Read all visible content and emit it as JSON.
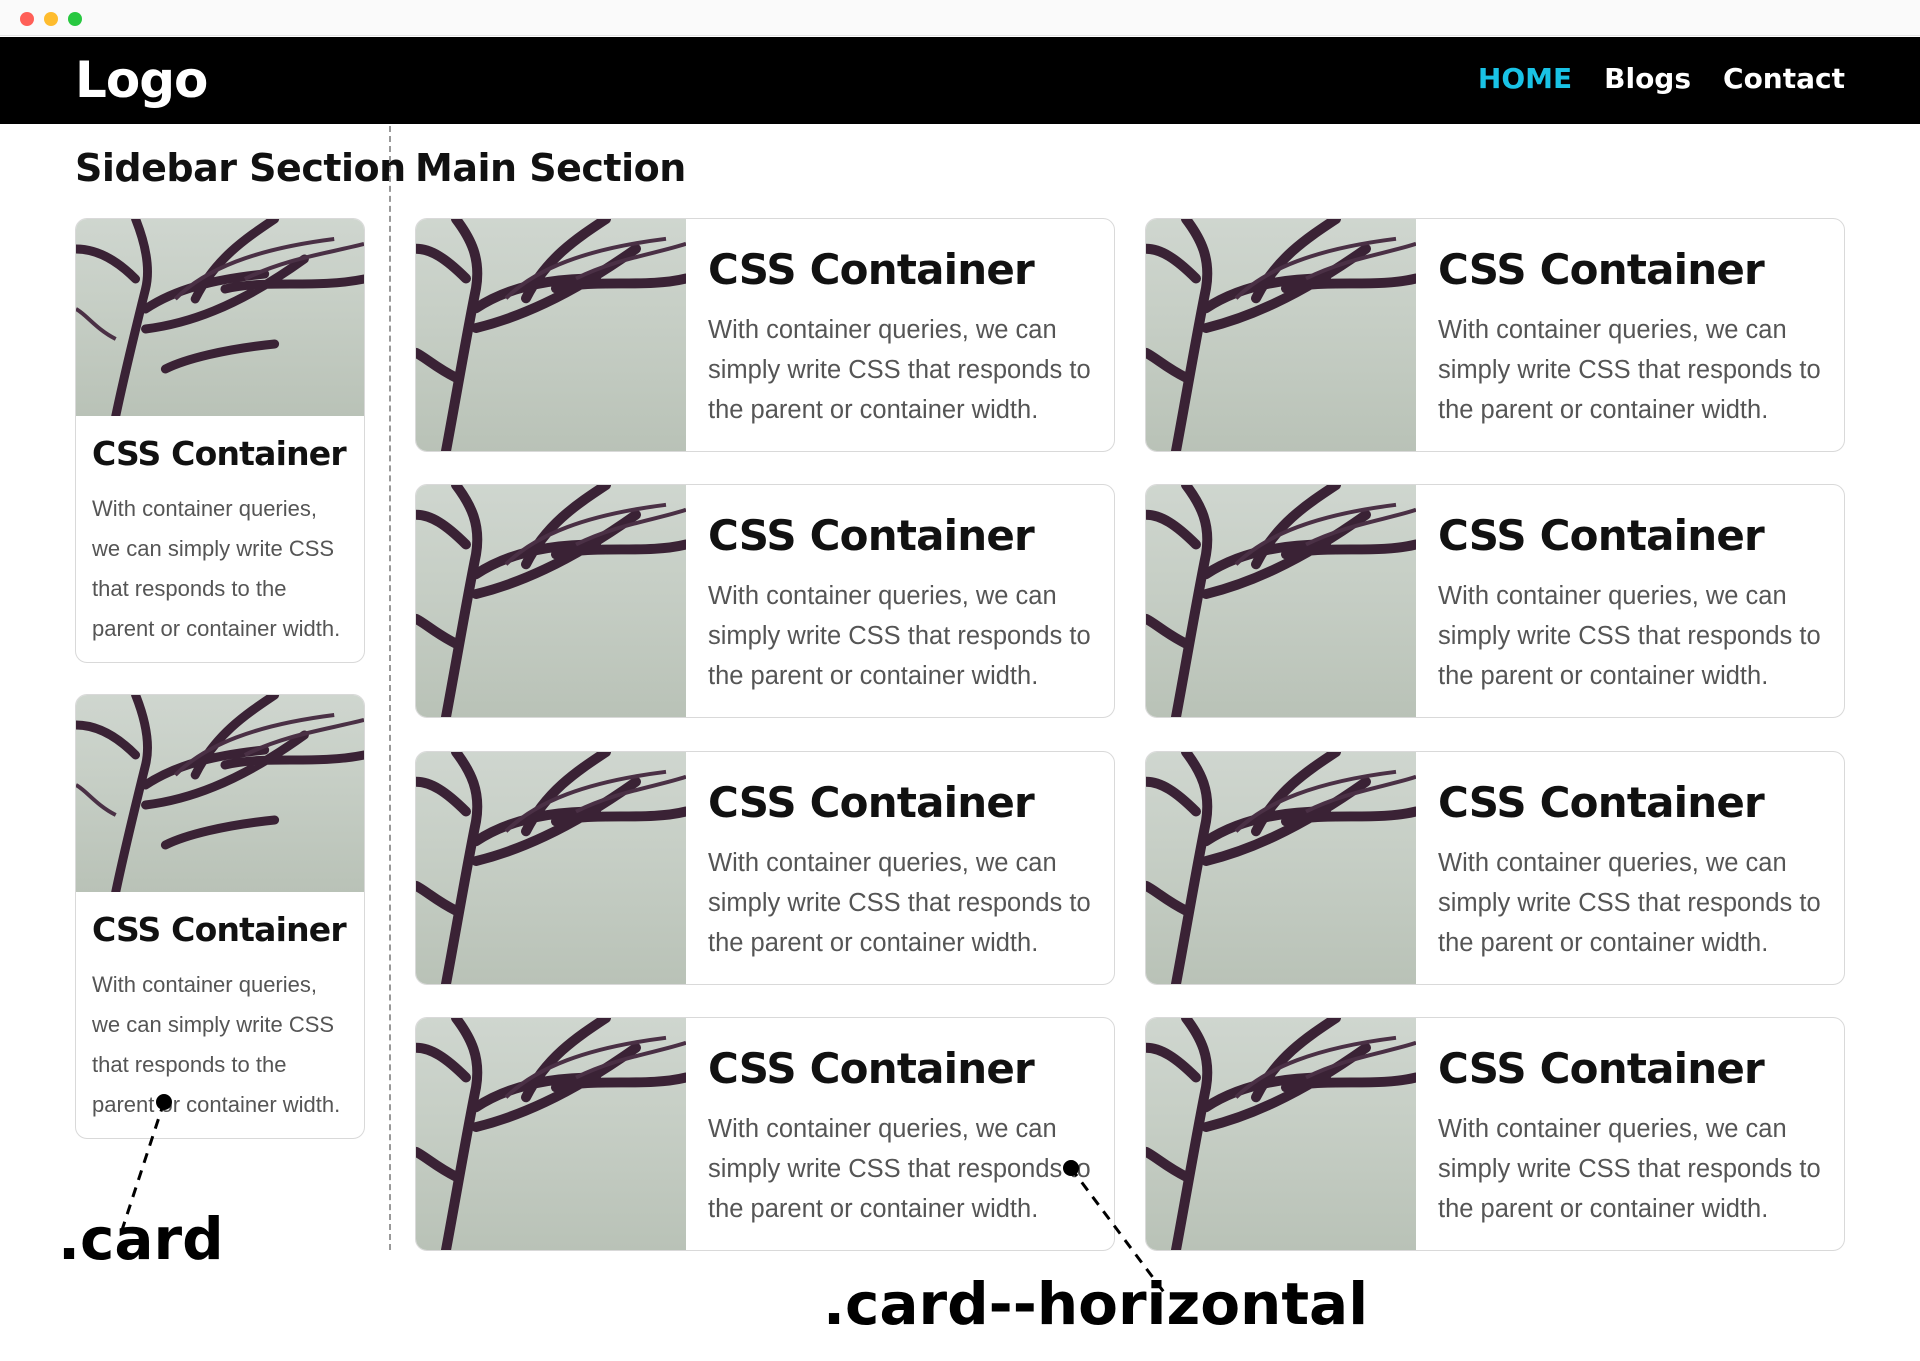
{
  "nav": {
    "logo": "Logo",
    "links": [
      "HOME",
      "Blogs",
      "Contact"
    ],
    "active_color": "#19c3e6"
  },
  "sidebar": {
    "title": "Sidebar Section",
    "cards": [
      {
        "title": "CSS Container",
        "text": "With container queries, we can simply write CSS that responds to the parent or container width."
      },
      {
        "title": "CSS Container",
        "text": "With container queries, we can simply write CSS that responds to the parent or container width."
      }
    ]
  },
  "main": {
    "title": "Main Section",
    "cards": [
      {
        "title": "CSS Container",
        "text": "With container queries, we can simply write CSS that responds to the parent or container width."
      },
      {
        "title": "CSS Container",
        "text": "With container queries, we can simply write CSS that responds to the parent or container width."
      },
      {
        "title": "CSS Container",
        "text": "With container queries, we can simply write CSS that responds to the parent or container width."
      },
      {
        "title": "CSS Container",
        "text": "With container queries, we can simply write CSS that responds to the parent or container width."
      },
      {
        "title": "CSS Container",
        "text": "With container queries, we can simply write CSS that responds to the parent or container width."
      },
      {
        "title": "CSS Container",
        "text": "With container queries, we can simply write CSS that responds to the parent or container width."
      },
      {
        "title": "CSS Container",
        "text": "With container queries, we can simply write CSS that responds to the parent or container width."
      },
      {
        "title": "CSS Container",
        "text": "With container queries, we can simply write CSS that responds to the parent or container width."
      }
    ]
  },
  "annotations": {
    "card_label": ".card",
    "card_horizontal_label": ".card--horizontal"
  }
}
